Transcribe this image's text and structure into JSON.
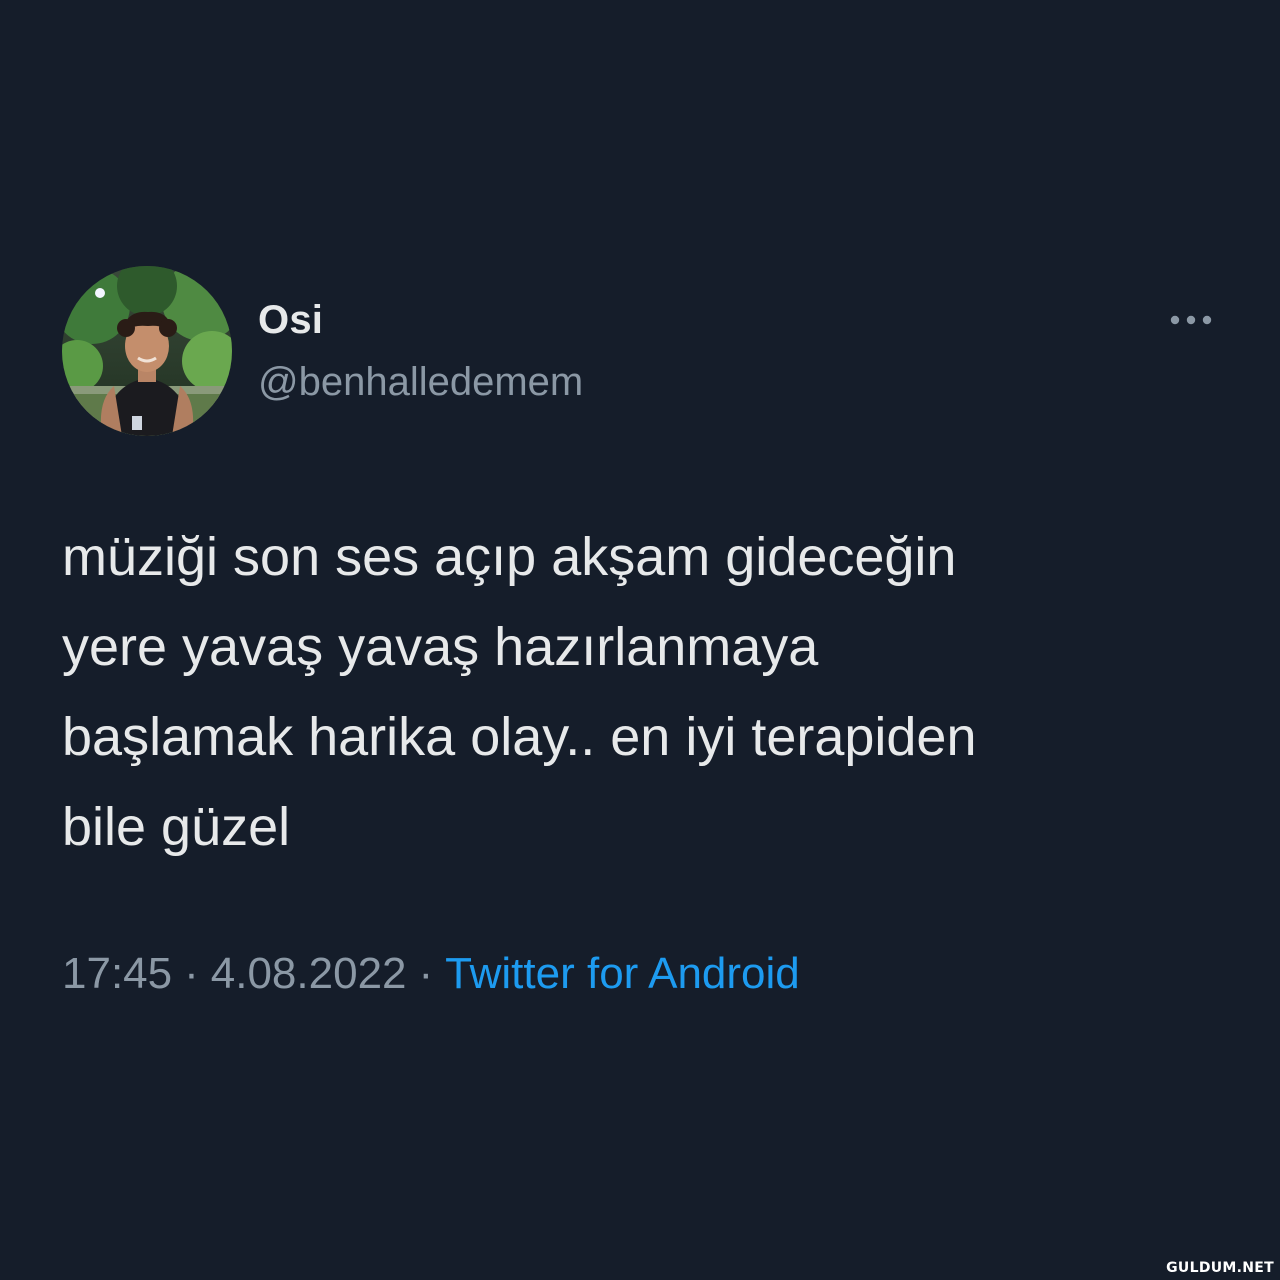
{
  "tweet": {
    "author": {
      "display_name": "Osi",
      "handle": "@benhalledemem",
      "avatar_icon": "profile-photo"
    },
    "menu_icon": "more-options-icon",
    "text": "müziği son ses açıp akşam gideceğin\nyere yavaş yavaş hazırlanmaya\nbaşlamak harika olay.. en iyi terapiden\nbile güzel",
    "time": "17:45",
    "date": "4.08.2022",
    "separator": "·",
    "source": "Twitter for Android"
  },
  "watermark": "GULDUM.NET",
  "colors": {
    "background": "#151d2a",
    "primary_text": "#e7e9ea",
    "secondary_text": "#8b98a5",
    "link": "#1d9bf0"
  }
}
